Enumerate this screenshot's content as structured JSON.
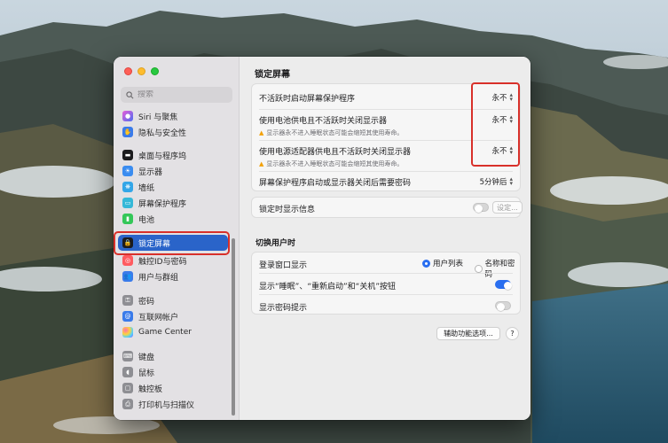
{
  "sidebar": {
    "search_placeholder": "搜索",
    "items": [
      {
        "label": "Siri 与聚焦",
        "icon": "siri-icon",
        "color": "#7a4ad8"
      },
      {
        "label": "隐私与安全性",
        "icon": "hand-icon",
        "color": "#3a7bea"
      },
      {
        "label": "桌面与程序坞",
        "icon": "dock-icon",
        "color": "#1c1c1e"
      },
      {
        "label": "显示器",
        "icon": "display-icon",
        "color": "#3a8cf0"
      },
      {
        "label": "墙纸",
        "icon": "wallpaper-icon",
        "color": "#33a6e8"
      },
      {
        "label": "屏幕保护程序",
        "icon": "screensaver-icon",
        "color": "#35b8d8"
      },
      {
        "label": "电池",
        "icon": "battery-icon",
        "color": "#34c759"
      },
      {
        "label": "锁定屏幕",
        "icon": "lock-icon",
        "color": "#1c1c1e"
      },
      {
        "label": "触控ID与密码",
        "icon": "fingerprint-icon",
        "color": "#ff5b60"
      },
      {
        "label": "用户与群组",
        "icon": "users-icon",
        "color": "#3a7bea"
      },
      {
        "label": "密码",
        "icon": "key-icon",
        "color": "#8e8e93"
      },
      {
        "label": "互联网帐户",
        "icon": "at-icon",
        "color": "#3a7bea"
      },
      {
        "label": "Game Center",
        "icon": "gamecenter-icon",
        "color": "#e8e8e8"
      },
      {
        "label": "键盘",
        "icon": "keyboard-icon",
        "color": "#8e8e93"
      },
      {
        "label": "鼠标",
        "icon": "mouse-icon",
        "color": "#8e8e93"
      },
      {
        "label": "触控板",
        "icon": "trackpad-icon",
        "color": "#8e8e93"
      },
      {
        "label": "打印机与扫描仪",
        "icon": "printer-icon",
        "color": "#8e8e93"
      }
    ]
  },
  "main": {
    "title": "锁定屏幕",
    "rows": {
      "screensaver": {
        "label": "不活跃时启动屏幕保护程序",
        "value": "永不"
      },
      "battery_display": {
        "label": "使用电池供电且不活跃时关闭显示器",
        "note": "显示器永不进入睡眠状态可能会缩短其使用寿命。",
        "value": "永不"
      },
      "adapter_display": {
        "label": "使用电源适配器供电且不活跃时关闭显示器",
        "note": "显示器永不进入睡眠状态可能会缩短其使用寿命。",
        "value": "永不"
      },
      "require_password": {
        "label": "屏幕保护程序启动或显示器关闭后需要密码",
        "value": "5分钟后"
      },
      "show_message": {
        "label": "锁定时显示信息",
        "button": "设定..."
      }
    },
    "switch_users": {
      "title": "切换用户时",
      "login_window": {
        "label": "登录窗口显示",
        "options": [
          "用户列表",
          "名称和密码"
        ],
        "selected": "用户列表"
      },
      "show_buttons": {
        "label": "显示“睡眠”、“重新启动”和“关机”按钮",
        "on": true
      },
      "password_hint": {
        "label": "显示密码提示",
        "on": false
      }
    },
    "accessibility_button": "辅助功能选项...",
    "help_button": "?"
  },
  "colors": {
    "accent": "#2a64c9",
    "highlight_outline": "#d8302a"
  }
}
